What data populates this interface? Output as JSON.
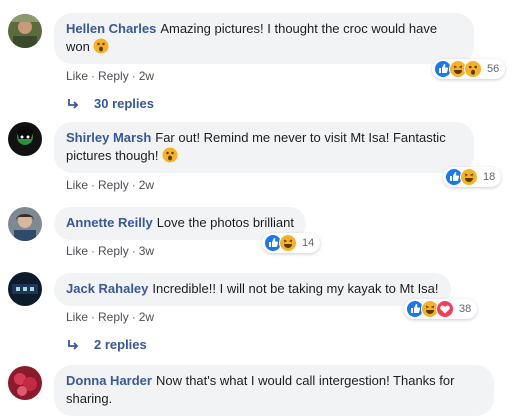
{
  "comments": [
    {
      "author": "Hellen Charles",
      "text": "Amazing pictures! I thought the croc would have won",
      "reaction_count": "56",
      "actions": {
        "like": "Like",
        "reply": "Reply",
        "time": "2w"
      },
      "replies_label": "30 replies"
    },
    {
      "author": "Shirley Marsh",
      "text": "Far out! Remind me never to visit Mt Isa! Fantastic pictures though!",
      "reaction_count": "18",
      "actions": {
        "like": "Like",
        "reply": "Reply",
        "time": "2w"
      }
    },
    {
      "author": "Annette Reilly",
      "text": "Love the photos brilliant",
      "reaction_count": "14",
      "actions": {
        "like": "Like",
        "reply": "Reply",
        "time": "3w"
      }
    },
    {
      "author": "Jack Rahaley",
      "text": "Incredible!! I will not be taking my kayak to Mt Isa!",
      "reaction_count": "38",
      "actions": {
        "like": "Like",
        "reply": "Reply",
        "time": "2w"
      },
      "replies_label": "2 replies"
    },
    {
      "author": "Donna Harder",
      "text": "Now that's what I would call intergestion! Thanks for sharing."
    }
  ],
  "separator": "·",
  "colors": {
    "author": "#385898",
    "bubble": "#f2f3f5",
    "like_blue": "#1877f2",
    "haha_yellow": "#f7b125",
    "love_red": "#f33e58"
  }
}
